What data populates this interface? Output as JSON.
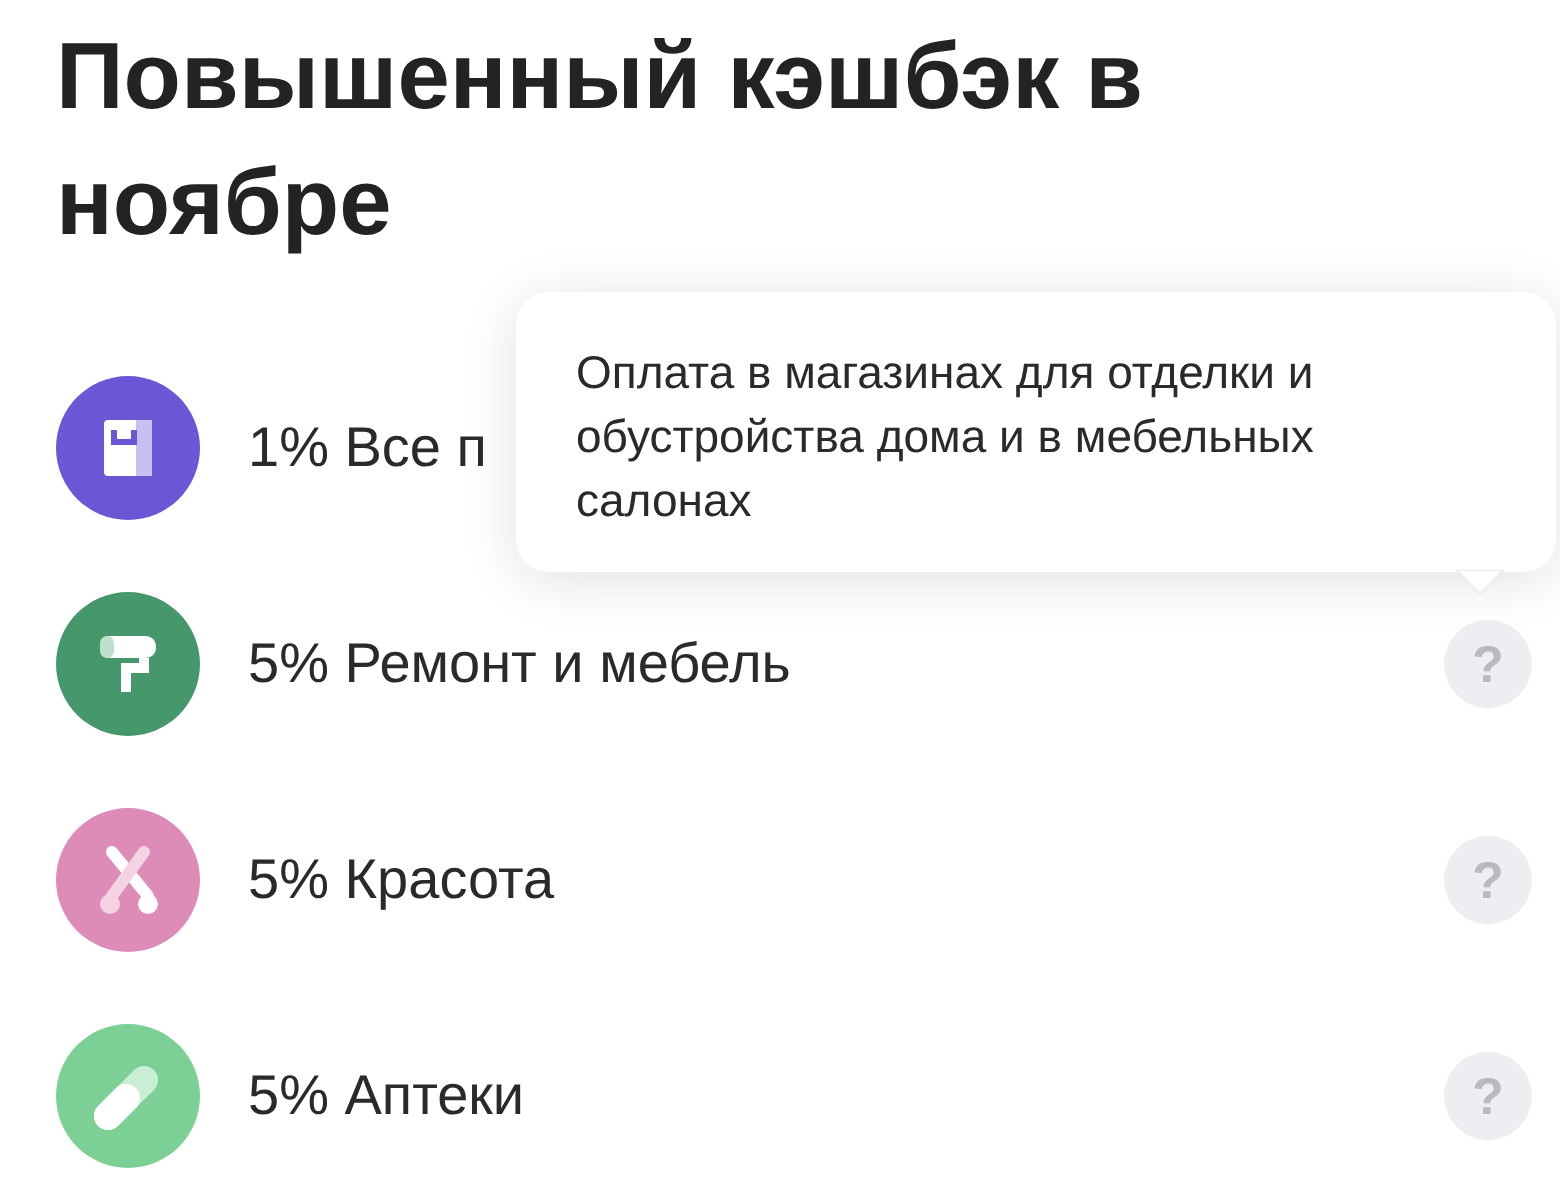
{
  "title": "Повышенный кэшбэк в ноябре",
  "categories": [
    {
      "kind": "bag",
      "color": "#6a57d6",
      "label": "1% Все п"
    },
    {
      "kind": "roller",
      "color": "#47976d",
      "label": "5% Ремонт и мебель",
      "help": true
    },
    {
      "kind": "scissors",
      "color": "#dc8cb6",
      "label": "5% Красота",
      "help": true
    },
    {
      "kind": "pill",
      "color": "#7dd095",
      "label": "5% Аптеки",
      "help": true
    }
  ],
  "help_symbol": "?",
  "tooltip": {
    "text": "Оплата в магазинах для отделки и обустройства дома и в мебельных салонах"
  }
}
